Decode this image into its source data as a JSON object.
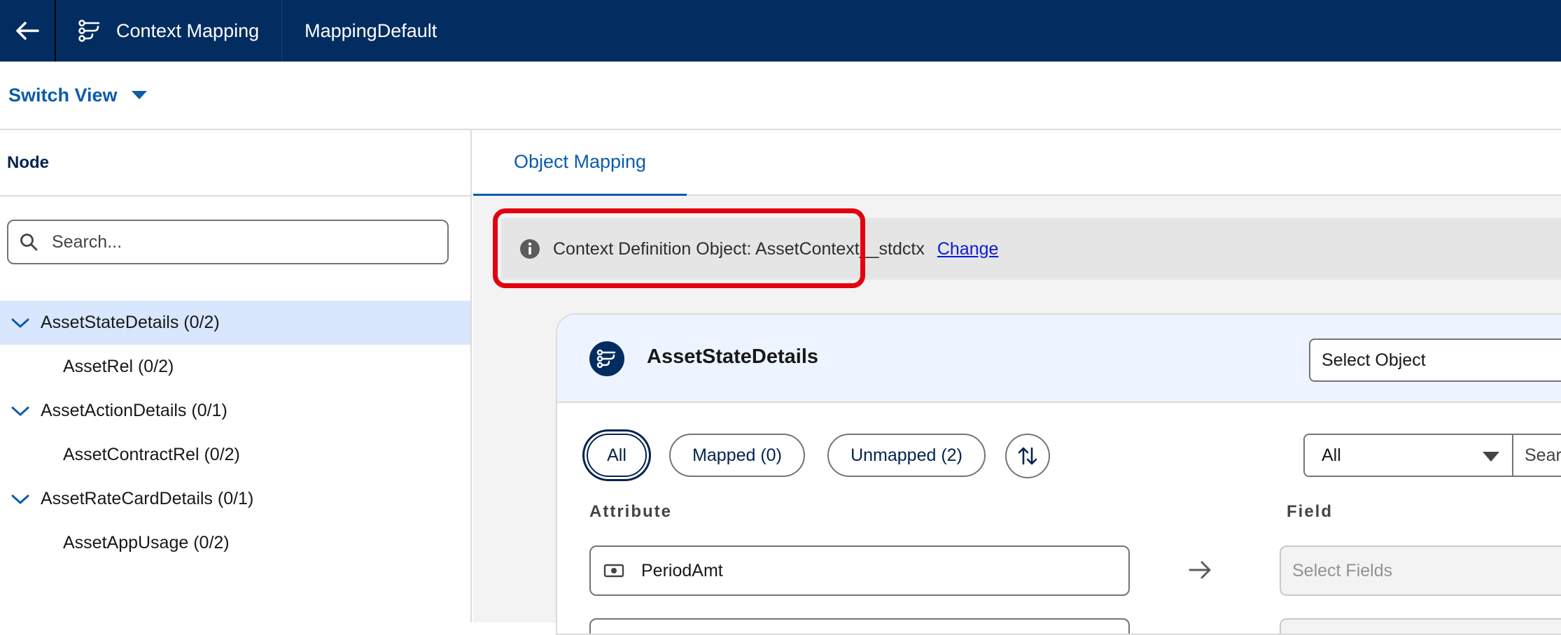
{
  "header": {
    "app_title": "Context Mapping",
    "mapping_name": "MappingDefault"
  },
  "switch_view": {
    "label": "Switch View"
  },
  "left_panel": {
    "node_header": "Node",
    "search_placeholder": "Search...",
    "tree": [
      {
        "label": "AssetStateDetails (0/2)",
        "level": "parent",
        "selected": true
      },
      {
        "label": "AssetRel (0/2)",
        "level": "child",
        "selected": false
      },
      {
        "label": "AssetActionDetails (0/1)",
        "level": "parent",
        "selected": false
      },
      {
        "label": "AssetContractRel (0/2)",
        "level": "child",
        "selected": false
      },
      {
        "label": "AssetRateCardDetails (0/1)",
        "level": "parent",
        "selected": false
      },
      {
        "label": "AssetAppUsage (0/2)",
        "level": "child",
        "selected": false
      }
    ]
  },
  "main": {
    "tab_label": "Object Mapping",
    "info": {
      "text": "Context Definition Object: AssetContext__stdctx",
      "link": "Change"
    },
    "card": {
      "title": "AssetStateDetails",
      "select_object_placeholder": "Select Object",
      "filters": {
        "all": "All",
        "mapped": "Mapped (0)",
        "unmapped": "Unmapped (2)"
      },
      "type_filter_value": "All",
      "search_placeholder": "Search...",
      "columns": {
        "attribute": "Attribute",
        "field": "Field"
      },
      "rows": [
        {
          "attribute": "PeriodAmt",
          "field_placeholder": "Select Fields"
        }
      ]
    }
  },
  "colors": {
    "header_bg": "#032d60",
    "accent": "#0b5cab",
    "highlight": "#e3000f",
    "selected_bg": "#d8e6fe"
  }
}
